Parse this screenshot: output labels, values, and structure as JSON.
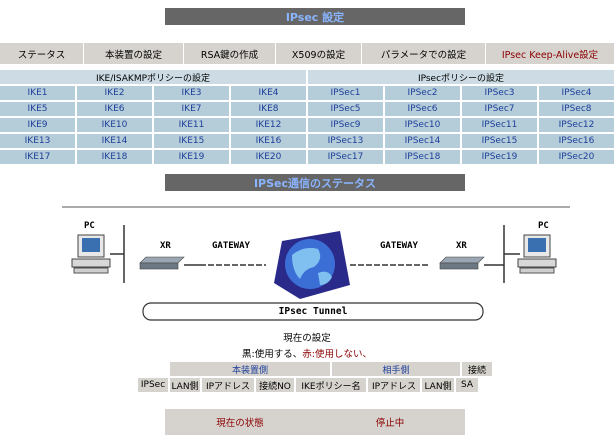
{
  "title": "IPsec 設定",
  "tabs": [
    "ステータス",
    "本装置の設定",
    "RSA鍵の作成",
    "X509の設定",
    "パラメータでの設定",
    "IPsec Keep-Alive設定"
  ],
  "ike_header": "IKE/ISAKMPポリシーの設定",
  "ipsec_header": "IPsecポリシーの設定",
  "ike_items": [
    "IKE1",
    "IKE2",
    "IKE3",
    "IKE4",
    "IKE5",
    "IKE6",
    "IKE7",
    "IKE8",
    "IKE9",
    "IKE10",
    "IKE11",
    "IKE12",
    "IKE13",
    "IKE14",
    "IKE15",
    "IKE16",
    "IKE17",
    "IKE18",
    "IKE19",
    "IKE20"
  ],
  "ipsec_items": [
    "IPSec1",
    "IPSec2",
    "IPSec3",
    "IPSec4",
    "IPSec5",
    "IPSec6",
    "IPSec7",
    "IPSec8",
    "IPSec9",
    "IPSec10",
    "IPSec11",
    "IPSec12",
    "IPSec13",
    "IPSec14",
    "IPSec15",
    "IPSec16",
    "IPSec17",
    "IPSec18",
    "IPSec19",
    "IPSec20"
  ],
  "status_title": "IPSec通信のステータス",
  "diagram": {
    "pc_left": "PC",
    "xr_left": "XR",
    "gateway_left": "GATEWAY",
    "gateway_right": "GATEWAY",
    "xr_right": "XR",
    "pc_right": "PC",
    "tunnel": "IPsec Tunnel"
  },
  "current_settings": "現在の設定",
  "legend": {
    "black": "黒:使用する、",
    "red": "赤:使用しない、"
  },
  "status_table": {
    "group_local": "本装置側",
    "group_remote": "相手側",
    "group_conn": "接続",
    "columns": [
      "IPSec",
      "LAN側",
      "IPアドレス",
      "接続NO",
      "IKEポリシー名",
      "IPアドレス",
      "LAN側",
      "SA"
    ]
  },
  "current_state": {
    "label": "現在の状態",
    "value": "停止中"
  },
  "colors": {
    "title_bg": "#666666",
    "title_text": "#8ab4ff",
    "cell_bg": "#b4cdd9",
    "cell_text": "#1f3f9a",
    "tab_bg": "#d6d3ce",
    "accent_red": "#8b0000"
  }
}
